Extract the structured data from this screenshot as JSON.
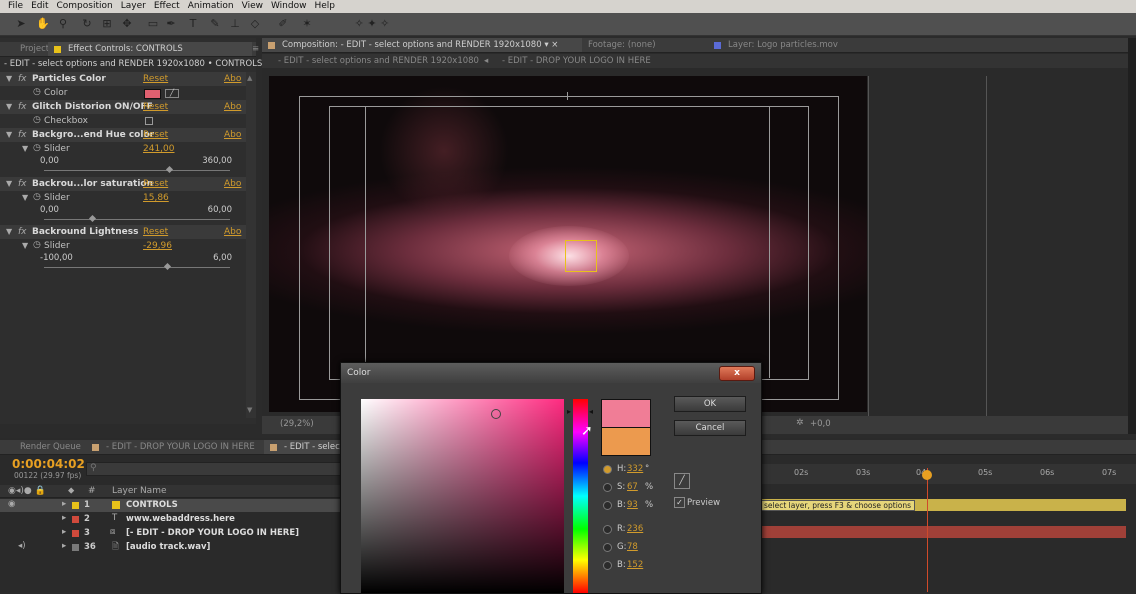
{
  "menu": [
    "File",
    "Edit",
    "Composition",
    "Layer",
    "Effect",
    "Animation",
    "View",
    "Window",
    "Help"
  ],
  "fx_panel": {
    "tab_project": "Project",
    "tab_effect_controls": "Effect Controls: CONTROLS",
    "breadcrumb": "- EDIT - select options and RENDER 1920x1080 • CONTROLS",
    "reset": "Reset",
    "about": "Abo",
    "effects": [
      {
        "name": "Particles Color",
        "prop": "Color",
        "color": "#e06070"
      },
      {
        "name": "Glitch Distorion ON/OFF",
        "prop": "Checkbox"
      },
      {
        "name": "Backgro...end Hue color",
        "prop": "Slider",
        "value": "241,00",
        "min": "0,00",
        "max": "360,00",
        "level": 0.67
      },
      {
        "name": "Backrou...lor saturation",
        "prop": "Slider",
        "value": "15,86",
        "min": "0,00",
        "max": "60,00",
        "level": 0.26
      },
      {
        "name": "Backround Lightness",
        "prop": "Slider",
        "value": "-29,96",
        "min": "-100,00",
        "max": "6,00",
        "level": 0.66
      }
    ]
  },
  "comp_panel": {
    "tab_comp": "Composition: - EDIT - select options and RENDER 1920x1080",
    "tab_footage": "Footage: (none)",
    "tab_layer": "Layer: Logo particles.mov",
    "nav_1": "- EDIT - select options and RENDER 1920x1080",
    "nav_2": "- EDIT - DROP YOUR LOGO IN HERE",
    "zoom": "(29,2%)",
    "exposure": "+0,0"
  },
  "timeline": {
    "tab_render": "Render Queue",
    "tab_logo": "- EDIT - DROP YOUR LOGO IN HERE",
    "tab_select": "- EDIT - select",
    "timecode": "0:00:04:02",
    "frames": "00122 (29.97 fps)",
    "col_hash": "#",
    "col_layer_name": "Layer Name",
    "ruler": [
      "02s",
      "03s",
      "04s",
      "05s",
      "06s",
      "07s"
    ],
    "layer_comment": "select layer, press F3 & choose options",
    "layers": [
      {
        "num": "1",
        "name": "CONTROLS",
        "color": "#e8c21a"
      },
      {
        "num": "2",
        "name": "www.webaddress.here",
        "color": "#d04a3c"
      },
      {
        "num": "3",
        "name": "[- EDIT - DROP YOUR LOGO IN HERE]",
        "color": "#d04a3c"
      },
      {
        "num": "36",
        "name": "[audio track.wav]",
        "color": "#7a7a7a"
      }
    ]
  },
  "color_dialog": {
    "title": "Color",
    "close": "x",
    "ok": "OK",
    "cancel": "Cancel",
    "preview": "Preview",
    "new_color": "#f07d96",
    "old_color": "#ec9a4e",
    "fields": [
      {
        "key": "H:",
        "value": "332",
        "unit": "°"
      },
      {
        "key": "S:",
        "value": "67",
        "unit": "%"
      },
      {
        "key": "B:",
        "value": "93",
        "unit": "%"
      },
      {
        "key": "R:",
        "value": "236",
        "unit": ""
      },
      {
        "key": "G:",
        "value": "78",
        "unit": ""
      },
      {
        "key": "B:",
        "value": "152",
        "unit": ""
      }
    ]
  }
}
